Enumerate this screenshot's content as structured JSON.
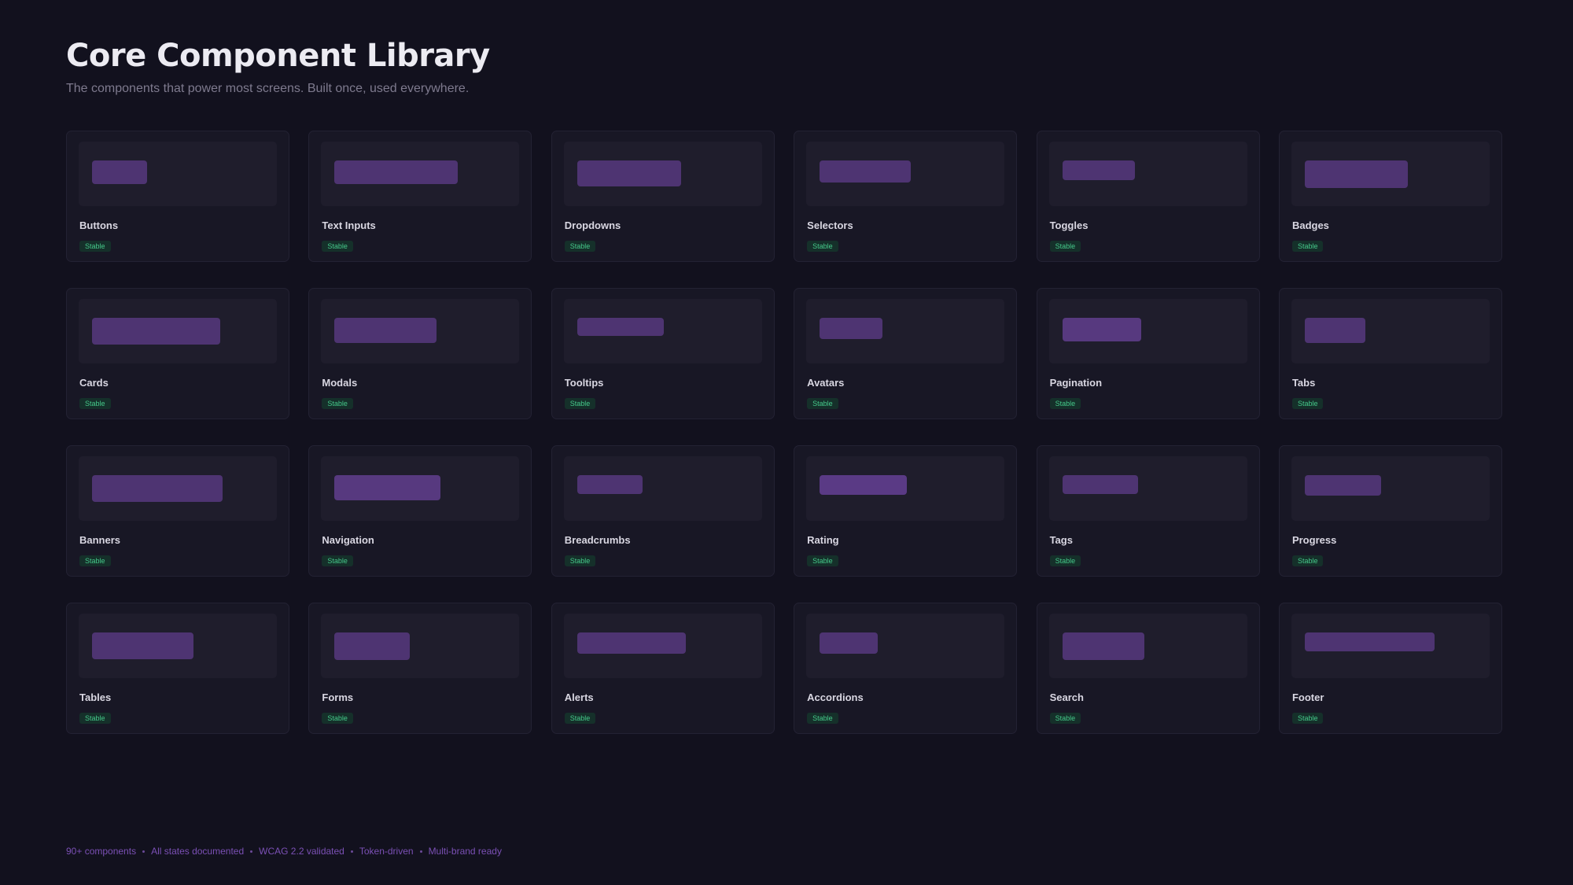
{
  "header": {
    "title": "Core Component Library",
    "subtitle": "The components that power most screens. Built once, used everywhere."
  },
  "colors": {
    "background": "#12111e",
    "card": "#181725",
    "preview": "#1f1d2c",
    "accent": "#4e3472",
    "status_green": "#45c98a",
    "footer_text": "#7b50b5"
  },
  "components": [
    {
      "name": "Buttons",
      "status": "Stable"
    },
    {
      "name": "Text Inputs",
      "status": "Stable"
    },
    {
      "name": "Dropdowns",
      "status": "Stable"
    },
    {
      "name": "Selectors",
      "status": "Stable"
    },
    {
      "name": "Toggles",
      "status": "Stable"
    },
    {
      "name": "Badges",
      "status": "Stable"
    },
    {
      "name": "Cards",
      "status": "Stable"
    },
    {
      "name": "Modals",
      "status": "Stable"
    },
    {
      "name": "Tooltips",
      "status": "Stable"
    },
    {
      "name": "Avatars",
      "status": "Stable"
    },
    {
      "name": "Pagination",
      "status": "Stable"
    },
    {
      "name": "Tabs",
      "status": "Stable"
    },
    {
      "name": "Banners",
      "status": "Stable"
    },
    {
      "name": "Navigation",
      "status": "Stable"
    },
    {
      "name": "Breadcrumbs",
      "status": "Stable"
    },
    {
      "name": "Rating",
      "status": "Stable"
    },
    {
      "name": "Tags",
      "status": "Stable"
    },
    {
      "name": "Progress",
      "status": "Stable"
    },
    {
      "name": "Tables",
      "status": "Stable"
    },
    {
      "name": "Forms",
      "status": "Stable"
    },
    {
      "name": "Alerts",
      "status": "Stable"
    },
    {
      "name": "Accordions",
      "status": "Stable"
    },
    {
      "name": "Search",
      "status": "Stable"
    },
    {
      "name": "Footer",
      "status": "Stable"
    }
  ],
  "footer": {
    "items": [
      "90+ components",
      "All states documented",
      "WCAG 2.2 validated",
      "Token-driven",
      "Multi-brand ready"
    ]
  }
}
